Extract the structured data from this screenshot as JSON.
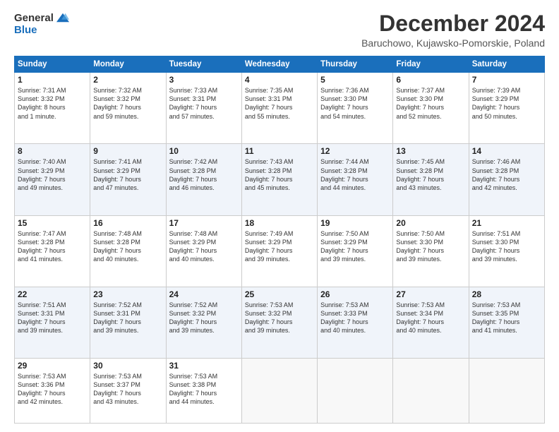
{
  "logo": {
    "general": "General",
    "blue": "Blue"
  },
  "title": "December 2024",
  "subtitle": "Baruchowo, Kujawsko-Pomorskie, Poland",
  "headers": [
    "Sunday",
    "Monday",
    "Tuesday",
    "Wednesday",
    "Thursday",
    "Friday",
    "Saturday"
  ],
  "weeks": [
    [
      {
        "day": "1",
        "detail": "Sunrise: 7:31 AM\nSunset: 3:32 PM\nDaylight: 8 hours\nand 1 minute."
      },
      {
        "day": "2",
        "detail": "Sunrise: 7:32 AM\nSunset: 3:32 PM\nDaylight: 7 hours\nand 59 minutes."
      },
      {
        "day": "3",
        "detail": "Sunrise: 7:33 AM\nSunset: 3:31 PM\nDaylight: 7 hours\nand 57 minutes."
      },
      {
        "day": "4",
        "detail": "Sunrise: 7:35 AM\nSunset: 3:31 PM\nDaylight: 7 hours\nand 55 minutes."
      },
      {
        "day": "5",
        "detail": "Sunrise: 7:36 AM\nSunset: 3:30 PM\nDaylight: 7 hours\nand 54 minutes."
      },
      {
        "day": "6",
        "detail": "Sunrise: 7:37 AM\nSunset: 3:30 PM\nDaylight: 7 hours\nand 52 minutes."
      },
      {
        "day": "7",
        "detail": "Sunrise: 7:39 AM\nSunset: 3:29 PM\nDaylight: 7 hours\nand 50 minutes."
      }
    ],
    [
      {
        "day": "8",
        "detail": "Sunrise: 7:40 AM\nSunset: 3:29 PM\nDaylight: 7 hours\nand 49 minutes."
      },
      {
        "day": "9",
        "detail": "Sunrise: 7:41 AM\nSunset: 3:29 PM\nDaylight: 7 hours\nand 47 minutes."
      },
      {
        "day": "10",
        "detail": "Sunrise: 7:42 AM\nSunset: 3:28 PM\nDaylight: 7 hours\nand 46 minutes."
      },
      {
        "day": "11",
        "detail": "Sunrise: 7:43 AM\nSunset: 3:28 PM\nDaylight: 7 hours\nand 45 minutes."
      },
      {
        "day": "12",
        "detail": "Sunrise: 7:44 AM\nSunset: 3:28 PM\nDaylight: 7 hours\nand 44 minutes."
      },
      {
        "day": "13",
        "detail": "Sunrise: 7:45 AM\nSunset: 3:28 PM\nDaylight: 7 hours\nand 43 minutes."
      },
      {
        "day": "14",
        "detail": "Sunrise: 7:46 AM\nSunset: 3:28 PM\nDaylight: 7 hours\nand 42 minutes."
      }
    ],
    [
      {
        "day": "15",
        "detail": "Sunrise: 7:47 AM\nSunset: 3:28 PM\nDaylight: 7 hours\nand 41 minutes."
      },
      {
        "day": "16",
        "detail": "Sunrise: 7:48 AM\nSunset: 3:28 PM\nDaylight: 7 hours\nand 40 minutes."
      },
      {
        "day": "17",
        "detail": "Sunrise: 7:48 AM\nSunset: 3:29 PM\nDaylight: 7 hours\nand 40 minutes."
      },
      {
        "day": "18",
        "detail": "Sunrise: 7:49 AM\nSunset: 3:29 PM\nDaylight: 7 hours\nand 39 minutes."
      },
      {
        "day": "19",
        "detail": "Sunrise: 7:50 AM\nSunset: 3:29 PM\nDaylight: 7 hours\nand 39 minutes."
      },
      {
        "day": "20",
        "detail": "Sunrise: 7:50 AM\nSunset: 3:30 PM\nDaylight: 7 hours\nand 39 minutes."
      },
      {
        "day": "21",
        "detail": "Sunrise: 7:51 AM\nSunset: 3:30 PM\nDaylight: 7 hours\nand 39 minutes."
      }
    ],
    [
      {
        "day": "22",
        "detail": "Sunrise: 7:51 AM\nSunset: 3:31 PM\nDaylight: 7 hours\nand 39 minutes."
      },
      {
        "day": "23",
        "detail": "Sunrise: 7:52 AM\nSunset: 3:31 PM\nDaylight: 7 hours\nand 39 minutes."
      },
      {
        "day": "24",
        "detail": "Sunrise: 7:52 AM\nSunset: 3:32 PM\nDaylight: 7 hours\nand 39 minutes."
      },
      {
        "day": "25",
        "detail": "Sunrise: 7:53 AM\nSunset: 3:32 PM\nDaylight: 7 hours\nand 39 minutes."
      },
      {
        "day": "26",
        "detail": "Sunrise: 7:53 AM\nSunset: 3:33 PM\nDaylight: 7 hours\nand 40 minutes."
      },
      {
        "day": "27",
        "detail": "Sunrise: 7:53 AM\nSunset: 3:34 PM\nDaylight: 7 hours\nand 40 minutes."
      },
      {
        "day": "28",
        "detail": "Sunrise: 7:53 AM\nSunset: 3:35 PM\nDaylight: 7 hours\nand 41 minutes."
      }
    ],
    [
      {
        "day": "29",
        "detail": "Sunrise: 7:53 AM\nSunset: 3:36 PM\nDaylight: 7 hours\nand 42 minutes."
      },
      {
        "day": "30",
        "detail": "Sunrise: 7:53 AM\nSunset: 3:37 PM\nDaylight: 7 hours\nand 43 minutes."
      },
      {
        "day": "31",
        "detail": "Sunrise: 7:53 AM\nSunset: 3:38 PM\nDaylight: 7 hours\nand 44 minutes."
      },
      {
        "day": "",
        "detail": ""
      },
      {
        "day": "",
        "detail": ""
      },
      {
        "day": "",
        "detail": ""
      },
      {
        "day": "",
        "detail": ""
      }
    ]
  ]
}
